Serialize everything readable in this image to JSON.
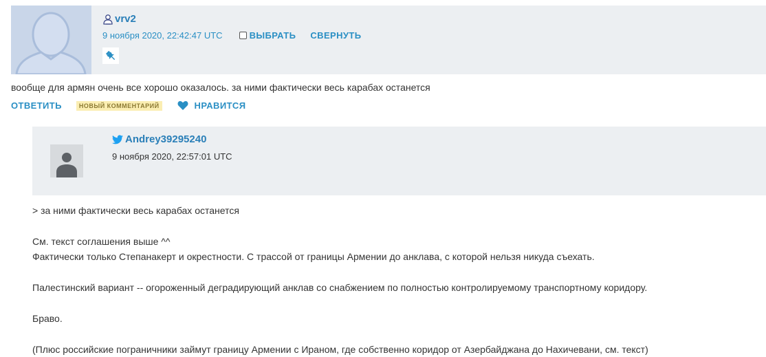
{
  "comment1": {
    "username": "vrv2",
    "timestamp": "9 ноября 2020, 22:42:47 UTC",
    "select_label": "ВЫБРАТЬ",
    "collapse_label": "СВЕРНУТЬ",
    "text": "вообще для армян очень все хорошо оказалось. за ними фактически весь карабах останется",
    "reply_label": "ОТВЕТИТЬ",
    "new_badge": "НОВЫЙ КОММЕНТАРИЙ",
    "like_label": "НРАВИТСЯ",
    "user_icon": "lj-user-icon",
    "pin_icon": "pin-icon",
    "like_icon": "heart-icon"
  },
  "comment2": {
    "username": "Andrey39295240",
    "timestamp": "9 ноября 2020, 22:57:01 UTC",
    "user_icon": "twitter-bird-icon",
    "paragraphs": [
      [
        "> за ними фактически весь карабах останется"
      ],
      [
        "См. текст соглашения выше ^^",
        "Фактически только Степанакерт и окрестности. С трассой от границы Армении до анклава, с которой нельзя никуда съехать."
      ],
      [
        "Палестинский вариант -- огороженный деградирующий анклав со снабжением по полностью контролируемому транспортному коридору."
      ],
      [
        "Браво."
      ],
      [
        "(Плюс российские пограничники займут границу Армении с Ираном, где собственно коридор от Азербайджана до Нахичевани, см. текст)"
      ]
    ]
  },
  "colors": {
    "link": "#2a8fc4",
    "header_bg": "#eceff2",
    "badge_bg": "#fbeeb2",
    "twitter": "#1da1f2"
  }
}
